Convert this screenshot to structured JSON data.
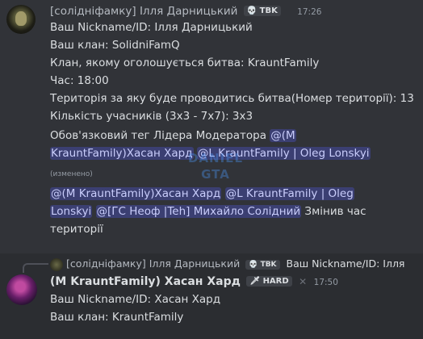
{
  "message1": {
    "author": "[солідніфамку] Ілля Дарницький",
    "tag": "TBK",
    "time": "17:26",
    "lines": [
      "Ваш Nickname/ID: Ілля Дарницький",
      "Ваш клан: SolidniFamQ",
      "Клан, якому оголошується битва: KrauntFamily",
      "Час: 18:00",
      "Територія за яку буде проводитись битва(Номер території):  13",
      "Кількість учасників (3х3 - 7х7): 3х3"
    ],
    "leader_tag_label": "Обов'язковий тег Лідера Модератора",
    "mention_a1": "@(M",
    "mention_a2": "KrauntFamily)Хасан Хард",
    "mention_b": "@L KrauntFamily | Oleg Lonskyi",
    "edited": "(изменено)",
    "mention_c": "@(M KrauntFamily)Хасан Хард",
    "mention_d1": "@L KrauntFamily | Oleg",
    "mention_d2": "Lonskyi",
    "mention_e": "@[ГС Неоф |Teh] Михайло Солідний",
    "note1": "Змінив час",
    "note2": "території"
  },
  "reply": {
    "author": "[солідніфамку] Ілля Дарницький",
    "tag": "TBK",
    "preview": "Ваш Nickname/ID: Ілля"
  },
  "message2": {
    "author": "(M KrauntFamily) Хасан Хард",
    "tag": "HARD",
    "time": "17:50",
    "lines": [
      "Ваш Nickname/ID:  Хасан Хард",
      "Ваш клан: KrauntFamily"
    ]
  },
  "watermark": {
    "top": "DANIEL",
    "bottom": "GTA"
  }
}
